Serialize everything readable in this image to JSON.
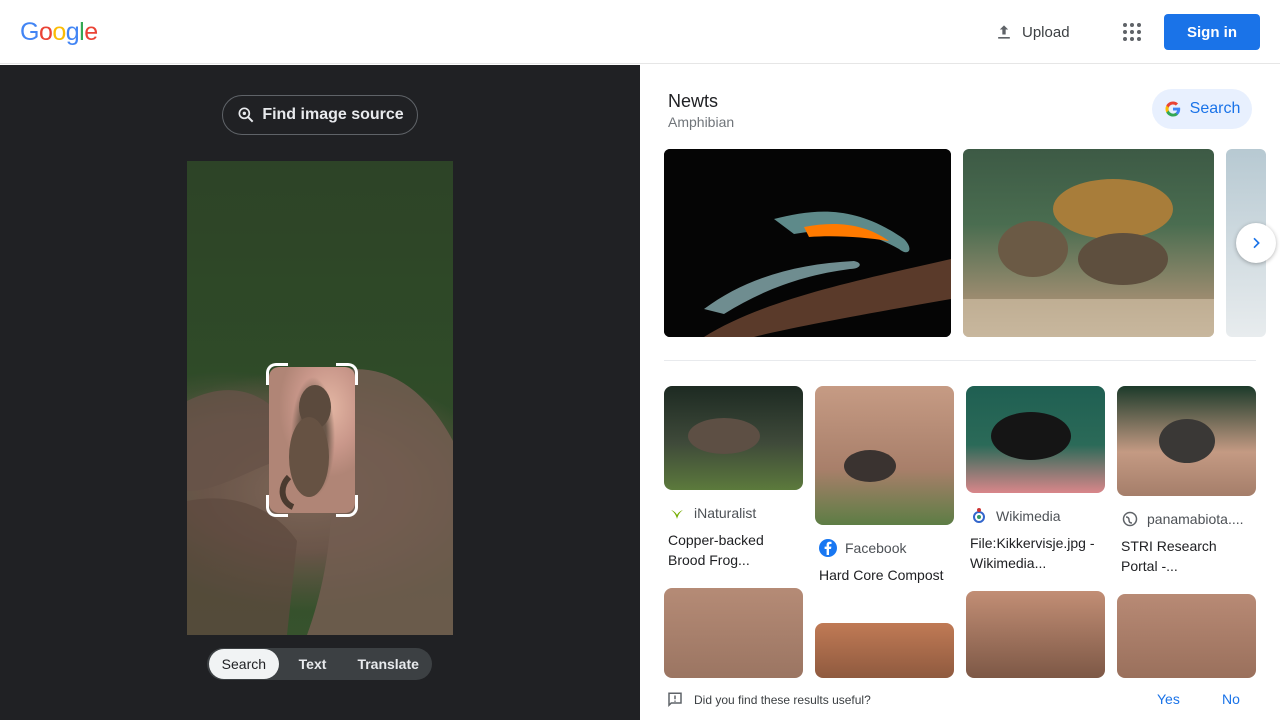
{
  "header": {
    "logo": [
      "G",
      "o",
      "o",
      "g",
      "l",
      "e"
    ],
    "logo_colors": [
      "#4285f4",
      "#ea4335",
      "#fbbc05",
      "#4285f4",
      "#34a853",
      "#ea4335"
    ],
    "upload_label": "Upload",
    "signin_label": "Sign in"
  },
  "left": {
    "find_source_label": "Find image source",
    "tabs": [
      {
        "label": "Search",
        "active": true
      },
      {
        "label": "Text",
        "active": false
      },
      {
        "label": "Translate",
        "active": false
      }
    ]
  },
  "knowledge": {
    "title": "Newts",
    "subtitle": "Amphibian",
    "search_label": "Search"
  },
  "results": [
    {
      "source": "iNaturalist",
      "title": "Copper-backed Brood Frog...",
      "favicon": "inaturalist-icon",
      "fav_color": "#74ac00"
    },
    {
      "source": "Facebook",
      "title": "Hard Core Compost",
      "favicon": "facebook-icon",
      "fav_color": "#1877f2"
    },
    {
      "source": "Wikimedia",
      "title": "File:Kikkervisje.jpg - Wikimedia...",
      "favicon": "wikimedia-icon",
      "fav_color": "#3366cc"
    },
    {
      "source": "panamabiota....",
      "title": "STRI Research Portal -...",
      "favicon": "globe-icon",
      "fav_color": "#5f6368"
    }
  ],
  "feedback": {
    "question": "Did you find these results useful?",
    "yes": "Yes",
    "no": "No"
  },
  "colors": {
    "accent": "#1a73e8",
    "dark_panel": "#202124"
  }
}
